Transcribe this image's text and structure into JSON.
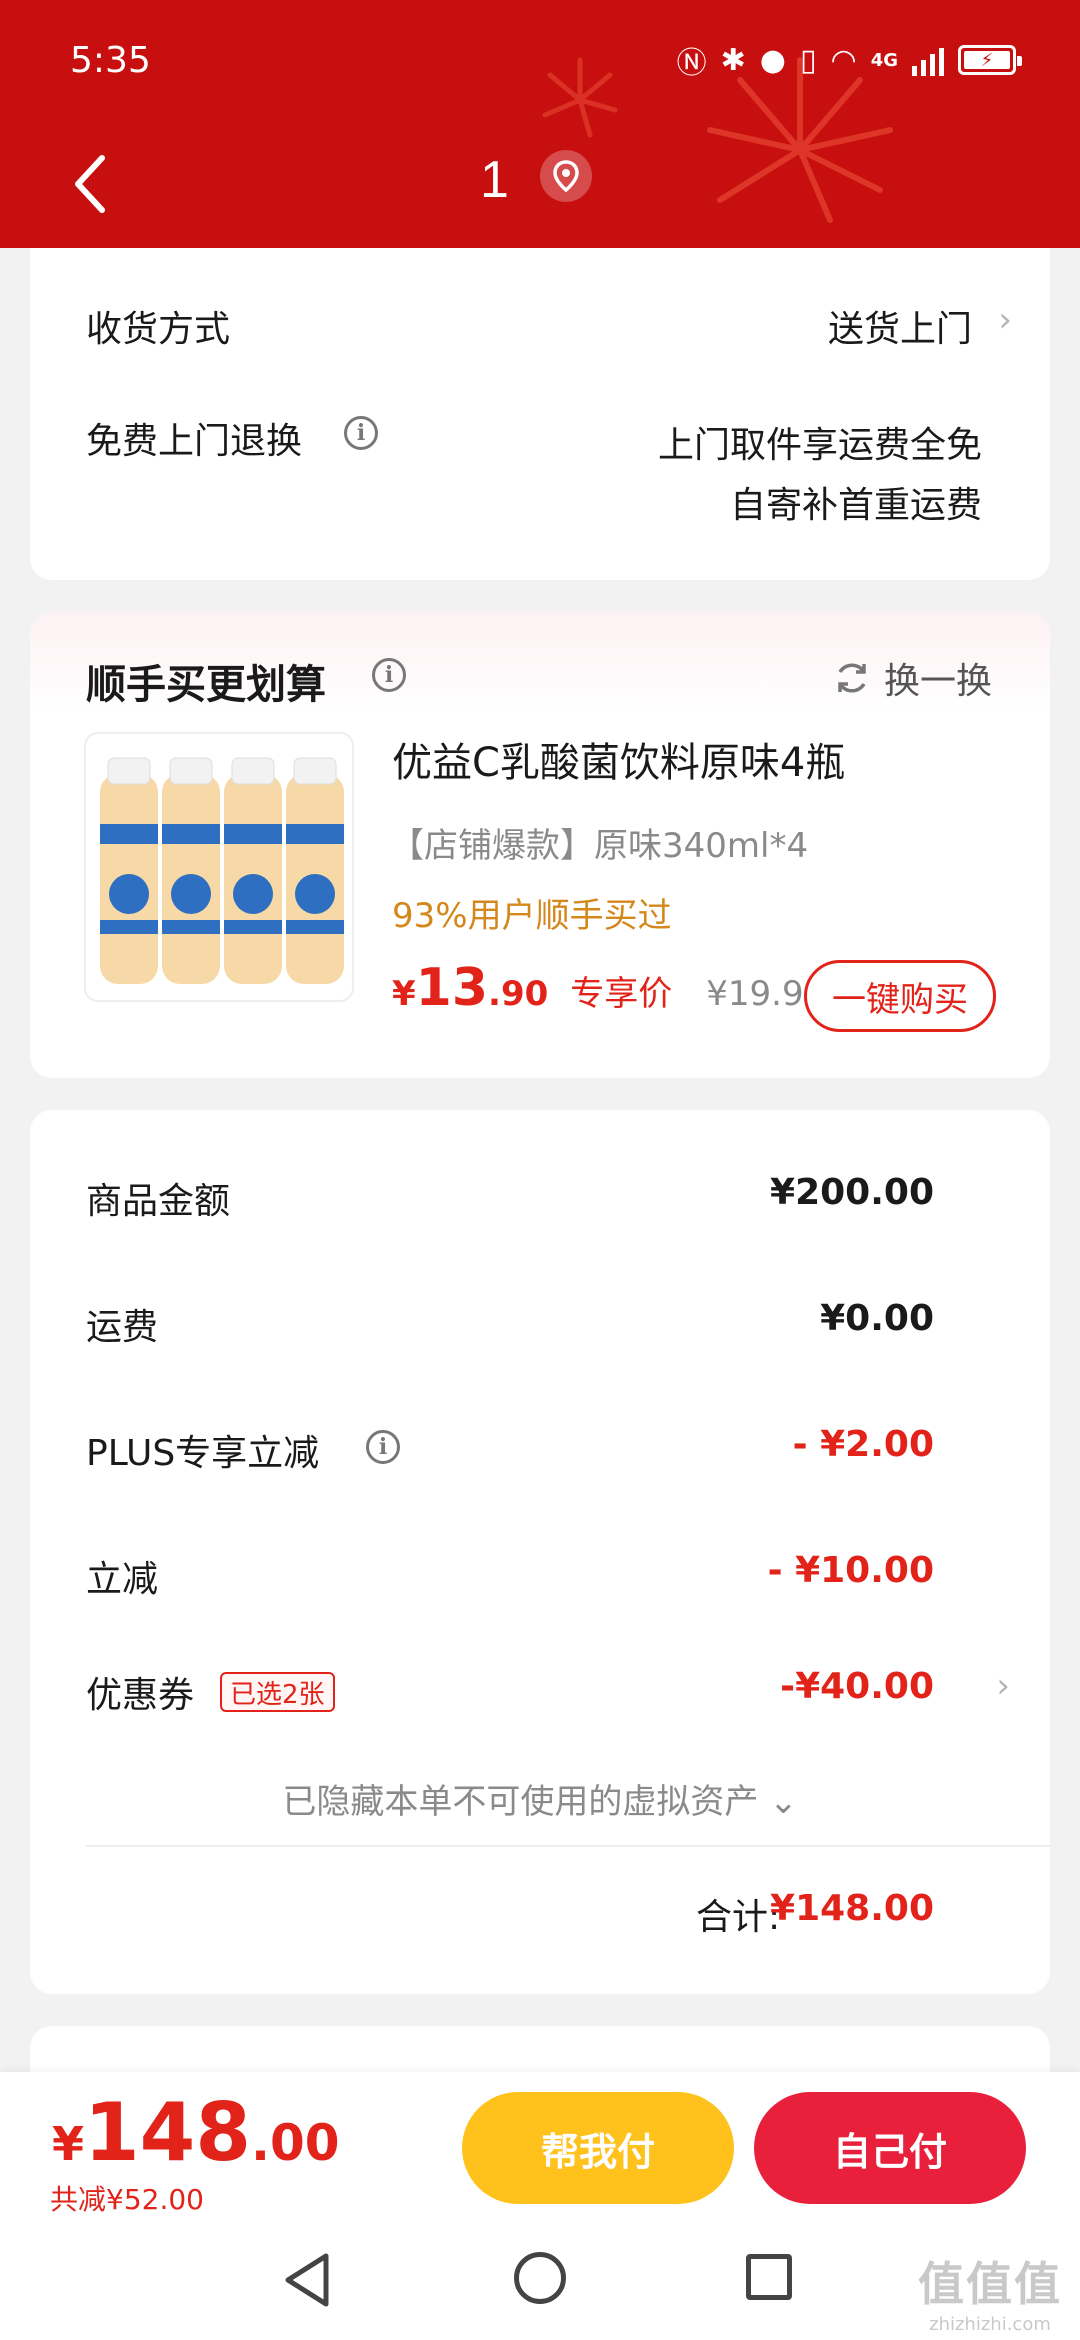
{
  "status_bar": {
    "time": "5:35",
    "network": "4G",
    "battery_level": 1.0
  },
  "nav": {
    "title": "1",
    "back_icon": "chevron-left-icon",
    "location_icon": "location-pin-icon"
  },
  "delivery": {
    "method_label": "收货方式",
    "method_value": "送货上门",
    "return_label": "免费上门退换",
    "return_value_line1": "上门取件享运费全免",
    "return_value_line2": "自寄补首重运费"
  },
  "upsell": {
    "title": "顺手买更划算",
    "refresh_label": "换一换",
    "product": {
      "name": "优益C乳酸菌饮料原味4瓶",
      "spec": "【店铺爆款】原味340ml*4",
      "buy_rate": "93%用户顺手买过",
      "price_symbol": "¥",
      "price_int": "13",
      "price_dec": ".90",
      "price_tag": "专享价",
      "original_price": "¥19.90",
      "buy_button": "一键购买"
    }
  },
  "summary": {
    "goods_label": "商品金额",
    "goods_value": "¥200.00",
    "shipping_label": "运费",
    "shipping_value": "¥0.00",
    "plus_label": "PLUS专享立减",
    "plus_value": "- ¥2.00",
    "discount_label": "立减",
    "discount_value": "- ¥10.00",
    "coupon_label": "优惠券",
    "coupon_tag": "已选2张",
    "coupon_value": "-¥40.00",
    "hidden_note": "已隐藏本单不可使用的虚拟资产 ⌄",
    "total_label": "合计:",
    "total_value": "¥148.00"
  },
  "paybar": {
    "symbol": "¥",
    "amount_int": "148",
    "amount_dec": ".00",
    "saved": "共减¥52.00",
    "help_pay": "帮我付",
    "self_pay": "自己付"
  },
  "watermark": {
    "big": "值值值",
    "small": "zhizhizhi.com"
  },
  "colors": {
    "header": "#c80f0f",
    "accent": "#e2231a",
    "help_button": "#ffc21d",
    "self_button": "#e8203b",
    "gold": "#d4881b"
  }
}
